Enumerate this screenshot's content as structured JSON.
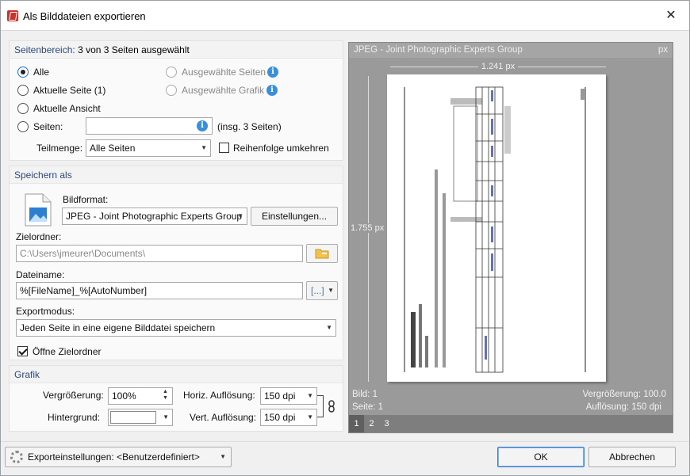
{
  "window": {
    "title": "Als Bilddateien exportieren",
    "close_glyph": "✕"
  },
  "page_range": {
    "heading_prefix": "Seitenbereich:",
    "heading_rest": "3 von 3 Seiten ausgewählt",
    "options": {
      "all": "Alle",
      "current_page": "Aktuelle Seite (1)",
      "current_view": "Aktuelle Ansicht",
      "pages": "Seiten:",
      "selected_pages": "Ausgewählte Seiten",
      "selected_graphic": "Ausgewählte Grafik"
    },
    "pages_value": "",
    "pages_total": "(insg. 3 Seiten)",
    "subset_label": "Teilmenge:",
    "subset_value": "Alle Seiten",
    "reverse_label": "Reihenfolge umkehren"
  },
  "save_as": {
    "heading": "Speichern als",
    "format_label": "Bildformat:",
    "format_value": "JPEG - Joint Photographic Experts Group",
    "settings_button": "Einstellungen...",
    "folder_label": "Zielordner:",
    "folder_value": "C:\\Users\\jmeurer\\Documents\\",
    "filename_label": "Dateiname:",
    "filename_value": "%[FileName]_%[AutoNumber]",
    "macro_button": "[...]",
    "export_mode_label": "Exportmodus:",
    "export_mode_value": "Jeden Seite in eine eigene Bilddatei speichern",
    "open_folder_label": "Öffne Zielordner"
  },
  "graphics": {
    "heading": "Grafik",
    "zoom_label": "Vergrößerung:",
    "zoom_value": "100%",
    "background_label": "Hintergrund:",
    "horiz_res_label": "Horiz. Auflösung:",
    "horiz_res_value": "150 dpi",
    "vert_res_label": "Vert. Auflösung:",
    "vert_res_value": "150 dpi"
  },
  "preview": {
    "format": "JPEG - Joint Photographic Experts Group",
    "unit": "px",
    "width_label": "1.241 px",
    "height_label": "1.755 px",
    "image_info": "Bild: 1",
    "page_info": "Seite: 1",
    "zoom_info": "Vergrößerung: 100.0",
    "resolution_info": "Auflösung: 150 dpi",
    "tabs": [
      "1",
      "2",
      "3"
    ]
  },
  "footer": {
    "export_settings_label": "Exporteinstellungen:",
    "export_settings_value": "<Benutzerdefiniert>",
    "ok": "OK",
    "cancel": "Abbrechen"
  }
}
